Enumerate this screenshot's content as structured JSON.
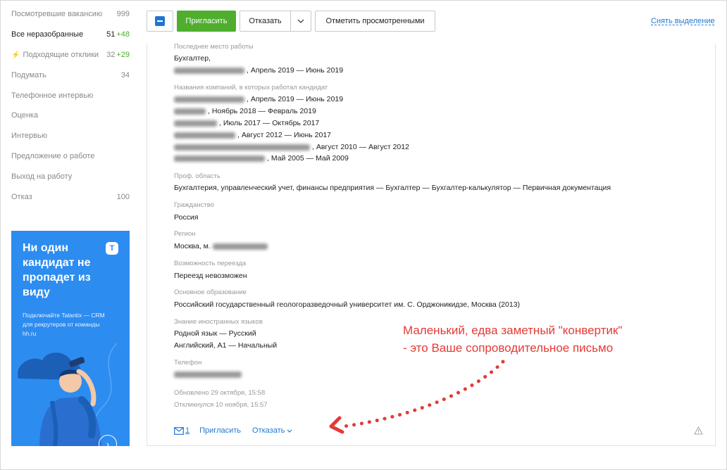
{
  "sidebar": {
    "items": [
      {
        "label": "Посмотревшие вакансию",
        "count": "999",
        "plus": ""
      },
      {
        "label": "Все неразобранные",
        "count": "51",
        "plus": "+48"
      },
      {
        "label": "Подходящие отклики",
        "count": "32",
        "plus": "+29"
      },
      {
        "label": "Подумать",
        "count": "34",
        "plus": ""
      },
      {
        "label": "Телефонное интервью",
        "count": "",
        "plus": ""
      },
      {
        "label": "Оценка",
        "count": "",
        "plus": ""
      },
      {
        "label": "Интервью",
        "count": "",
        "plus": ""
      },
      {
        "label": "Предложение о работе",
        "count": "",
        "plus": ""
      },
      {
        "label": "Выход на работу",
        "count": "",
        "plus": ""
      },
      {
        "label": "Отказ",
        "count": "100",
        "plus": ""
      }
    ]
  },
  "promo": {
    "title": "Ни один кандидат не пропадет из виду",
    "subtitle": "Подключайте Talantix — CRM для рекрутеров от команды hh.ru",
    "logo": "T"
  },
  "toolbar": {
    "invite_label": "Пригласить",
    "reject_label": "Отказать",
    "mark_viewed_label": "Отметить просмотренными",
    "deselect_label": "Снять выделение"
  },
  "resume": {
    "last_job_label": "Последнее место работы",
    "last_job_position": "Бухгалтер,",
    "last_job_period": ", Апрель 2019 — Июнь 2019",
    "companies_label": "Названия компаний, в которых работал кандидат",
    "companies": [
      ", Апрель 2019 — Июнь 2019",
      ", Ноябрь 2018 — Февраль 2019",
      ", Июль 2017 — Октябрь 2017",
      ", Август 2012 — Июнь 2017",
      ", Август 2010 — Август 2012",
      ", Май 2005 — Май 2009"
    ],
    "prof_label": "Проф. область",
    "prof_value": "Бухгалтерия, управленческий учет, финансы предприятия — Бухгалтер — Бухгалтер-калькулятор — Первичная документация",
    "citizenship_label": "Гражданство",
    "citizenship_value": "Россия",
    "region_label": "Регион",
    "region_value": "Москва, м.",
    "relocation_label": "Возможность переезда",
    "relocation_value": "Переезд невозможен",
    "education_label": "Основное образование",
    "education_value": "Российский государственный геологоразведочный университет им. С. Орджоникидзе, Москва (2013)",
    "languages_label": "Знание иностранных языков",
    "language_1": "Родной язык — Русский",
    "language_2": "Английский, A1 — Начальный",
    "phone_label": "Телефон",
    "updated": "Обновлено 29 октября, 15:58",
    "responded": "Откликнулся 10 ноября, 15:57"
  },
  "footer": {
    "letter_count": "1",
    "invite_label": "Пригласить",
    "reject_label": "Отказать"
  },
  "annotation": {
    "line1": "Маленький, едва заметный \"конвертик\"",
    "line2": "- это Ваше сопроводительное письмо",
    "color": "#e53a34"
  },
  "colors": {
    "accent_green": "#4fae2e",
    "link_blue": "#1f76d2",
    "promo_blue": "#2d8cf0"
  }
}
